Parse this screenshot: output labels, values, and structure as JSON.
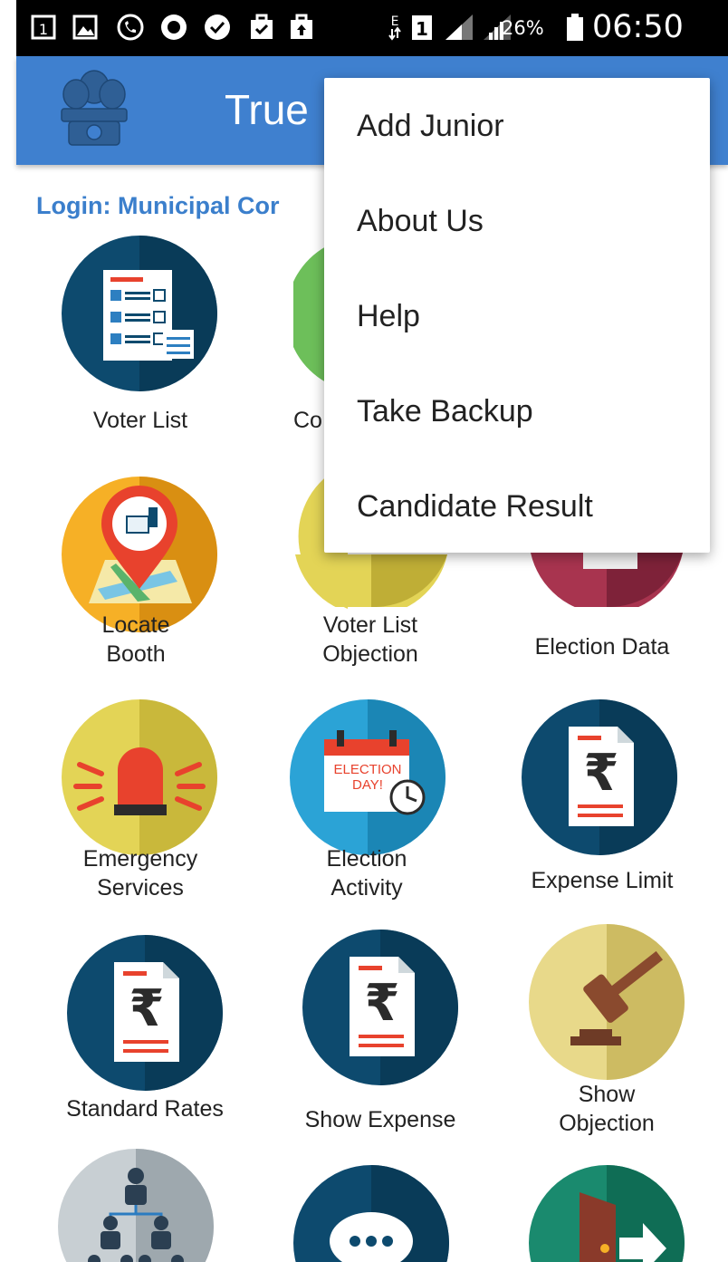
{
  "status_bar": {
    "icons": [
      "sim1-icon",
      "image-icon",
      "call-icon",
      "circle-icon",
      "whatsapp-icon",
      "bag-check-icon",
      "bag-up-icon",
      "data-e-icon",
      "sim-1-icon",
      "signal-icon",
      "signal-icon-2",
      "battery-icon"
    ],
    "battery": "26%",
    "time": "06:50"
  },
  "app_bar": {
    "title": "True",
    "logo": "emblem-icon"
  },
  "login_text": "Login: Municipal Cor",
  "grid": {
    "items": [
      {
        "label": "Voter List",
        "icon": "voter-list-icon"
      },
      {
        "label": "Co",
        "icon": "contact-icon"
      },
      {
        "label": "",
        "icon": "hidden-icon"
      },
      {
        "label_line1": "Locate",
        "label_line2": "Booth",
        "icon": "locate-booth-icon"
      },
      {
        "label_line1": "Voter List",
        "label_line2": "Objection",
        "icon": "voter-objection-icon"
      },
      {
        "label": "Election Data",
        "icon": "election-data-icon"
      },
      {
        "label_line1": "Emergency",
        "label_line2": "Services",
        "icon": "emergency-siren-icon"
      },
      {
        "label_line1": "Election",
        "label_line2": "Activity",
        "icon": "election-calendar-icon"
      },
      {
        "label": "Expense Limit",
        "icon": "rupee-document-icon"
      },
      {
        "label": "Standard Rates",
        "icon": "rupee-document-icon"
      },
      {
        "label": "Show Expense",
        "icon": "rupee-document-icon"
      },
      {
        "label_line1": "Show",
        "label_line2": "Objection",
        "icon": "gavel-icon"
      },
      {
        "label": "",
        "icon": "hierarchy-icon"
      },
      {
        "label": "",
        "icon": "chat-bubble-icon"
      },
      {
        "label": "",
        "icon": "exit-door-icon"
      }
    ],
    "calendar_text_1": "ELECTION",
    "calendar_text_2": "DAY!"
  },
  "overflow_menu": {
    "items": [
      "Add Junior",
      "About Us",
      "Help",
      "Take Backup",
      "Candidate Result"
    ]
  },
  "colors": {
    "app_bar": "#3f80cf",
    "login_text": "#3b7fcc",
    "navy": "#0d4a6e",
    "navy_dark": "#093b58",
    "yellow": "#e3d456",
    "orange": "#f6b026",
    "red": "#e8422d",
    "maroon": "#8e2a43",
    "green": "#1a8a6e"
  }
}
